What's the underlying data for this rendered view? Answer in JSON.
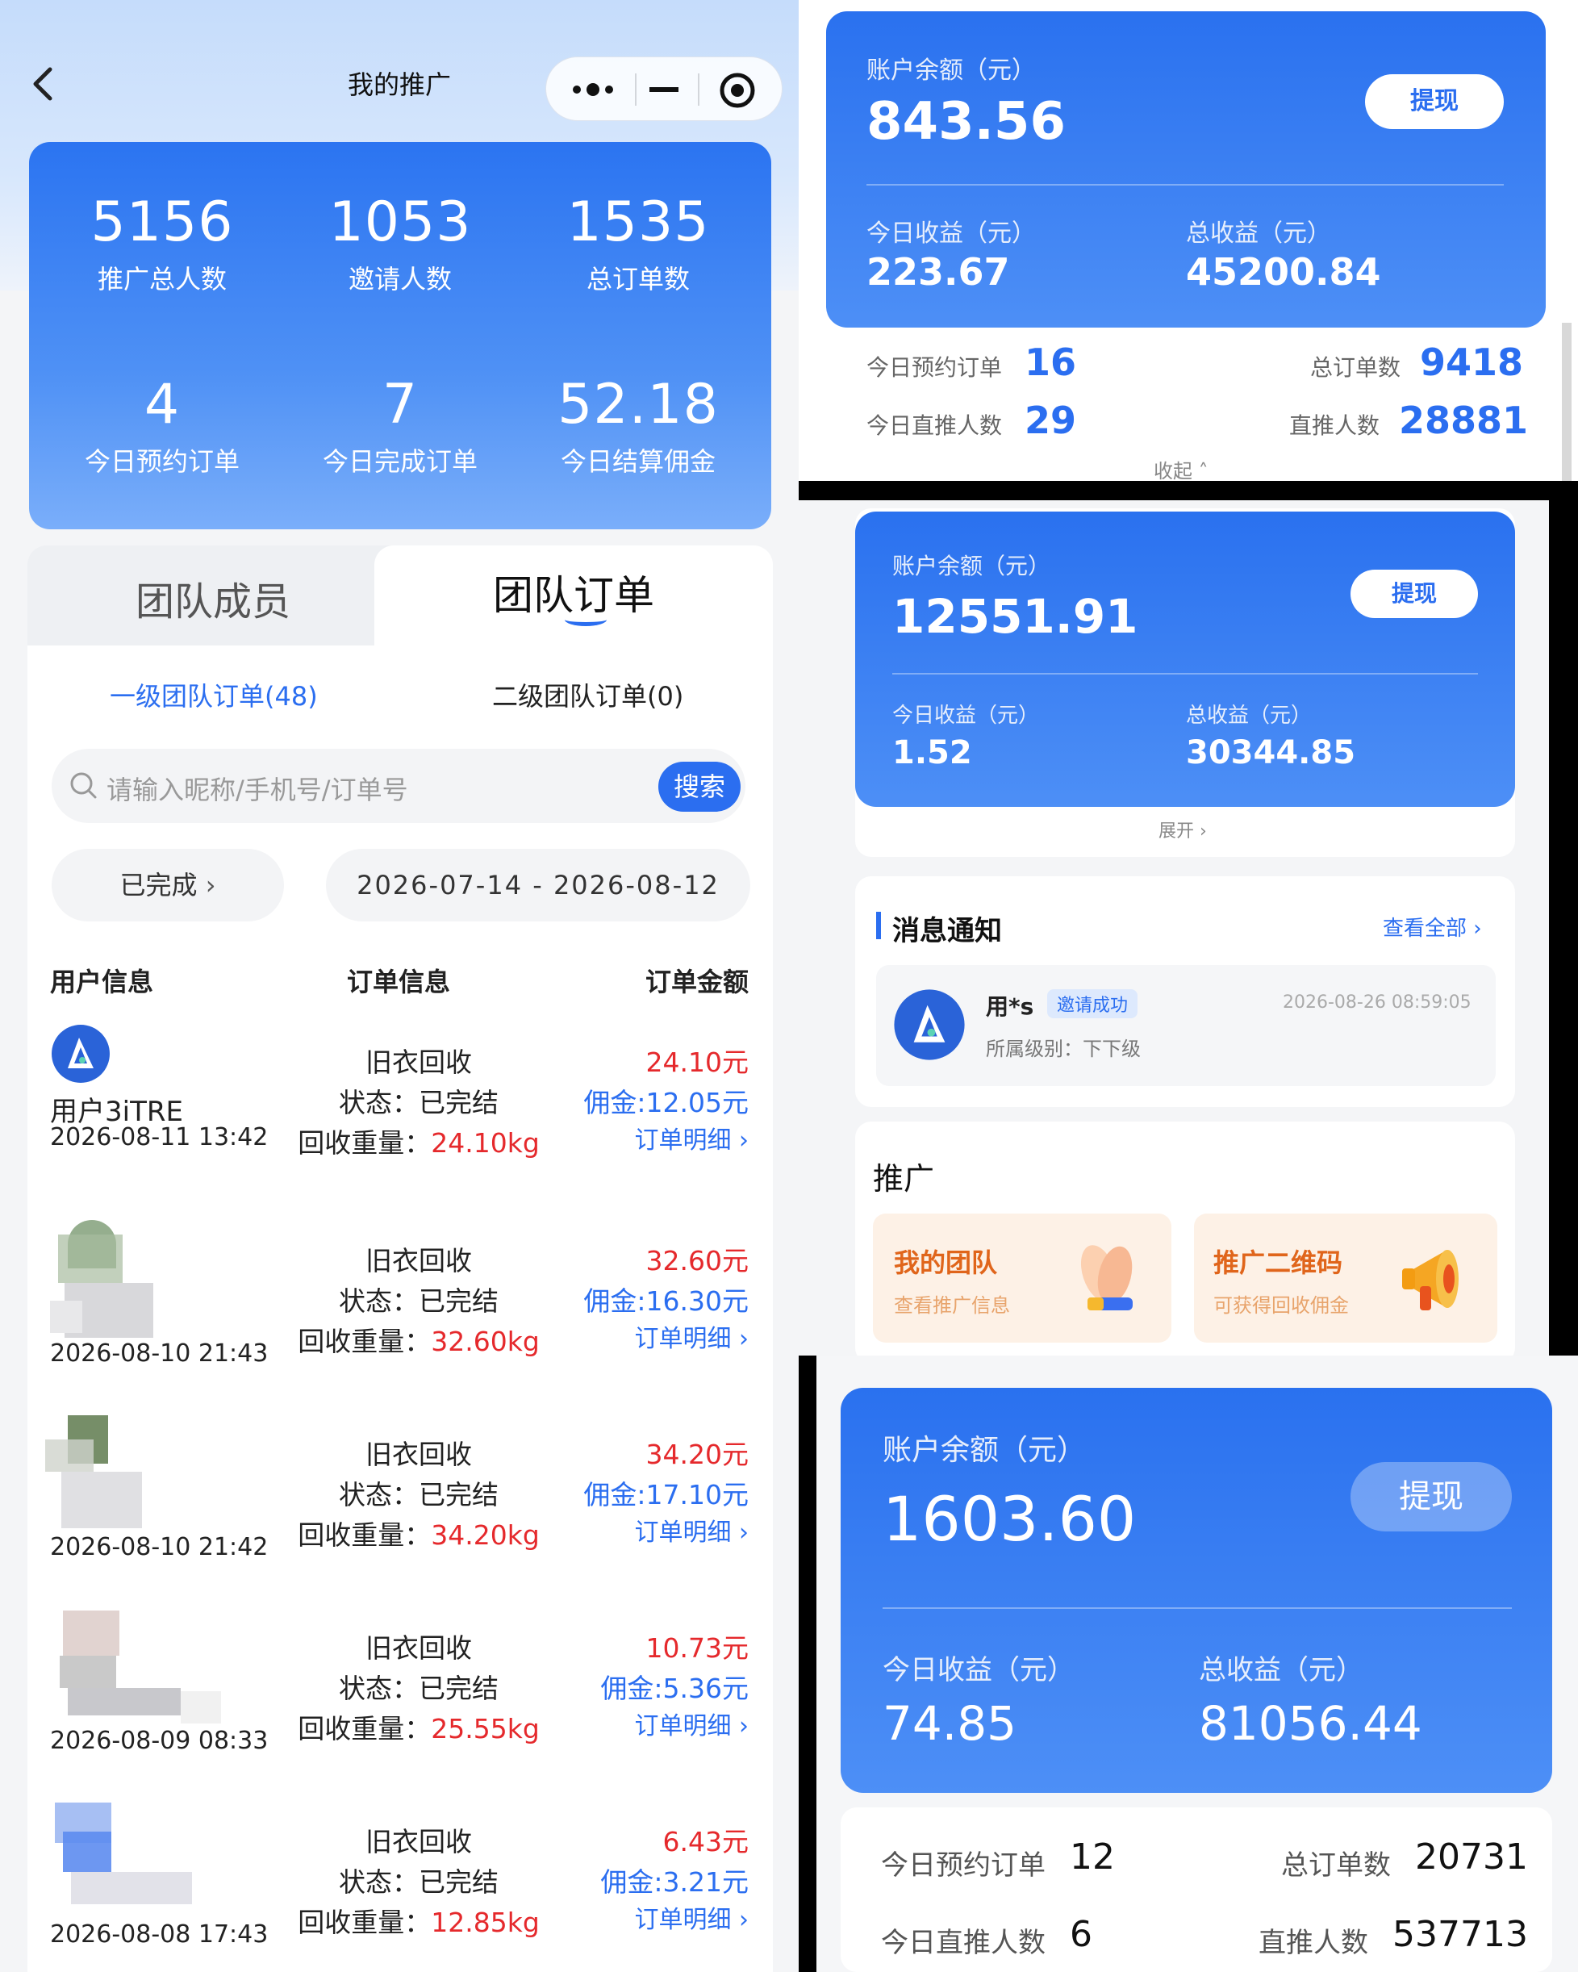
{
  "left": {
    "nav": {
      "title": "我的推广"
    },
    "stats": [
      {
        "value": "5156",
        "label": "推广总人数"
      },
      {
        "value": "1053",
        "label": "邀请人数"
      },
      {
        "value": "1535",
        "label": "总订单数"
      },
      {
        "value": "4",
        "label": "今日预约订单"
      },
      {
        "value": "7",
        "label": "今日完成订单"
      },
      {
        "value": "52.18",
        "label": "今日结算佣金"
      }
    ],
    "tabs": {
      "inactive": "团队成员",
      "active": "团队订单"
    },
    "subtabs": {
      "level1": "一级团队订单(48)",
      "level2": "二级团队订单(0)"
    },
    "search": {
      "placeholder": "请输入昵称/手机号/订单号",
      "button": "搜索"
    },
    "filters": {
      "status": "已完成",
      "date_range": "2026-07-14 - 2026-08-12"
    },
    "columns": {
      "user": "用户信息",
      "order": "订单信息",
      "amount": "订单金额"
    },
    "rows": [
      {
        "username": "用户3iTRE",
        "date": "2026-08-11 13:42",
        "type": "旧衣回收",
        "status_label": "状态：",
        "status": "已完结",
        "weight_label": "回收重量：",
        "weight": "24.10kg",
        "amount": "24.10元",
        "commission": "佣金:12.05元",
        "detail": "订单明细"
      },
      {
        "username": "",
        "date": "2026-08-10 21:43",
        "type": "旧衣回收",
        "status_label": "状态：",
        "status": "已完结",
        "weight_label": "回收重量：",
        "weight": "32.60kg",
        "amount": "32.60元",
        "commission": "佣金:16.30元",
        "detail": "订单明细"
      },
      {
        "username": "",
        "date": "2026-08-10 21:42",
        "type": "旧衣回收",
        "status_label": "状态：",
        "status": "已完结",
        "weight_label": "回收重量：",
        "weight": "34.20kg",
        "amount": "34.20元",
        "commission": "佣金:17.10元",
        "detail": "订单明细"
      },
      {
        "username": "",
        "date": "2026-08-09 08:33",
        "type": "旧衣回收",
        "status_label": "状态：",
        "status": "已完结",
        "weight_label": "回收重量：",
        "weight": "25.55kg",
        "amount": "10.73元",
        "commission": "佣金:5.36元",
        "detail": "订单明细"
      },
      {
        "username": "",
        "date": "2026-08-08 17:43",
        "type": "旧衣回收",
        "status_label": "状态：",
        "status": "已完结",
        "weight_label": "回收重量：",
        "weight": "12.85kg",
        "amount": "6.43元",
        "commission": "佣金:3.21元",
        "detail": "订单明细"
      }
    ]
  },
  "rt": {
    "balance_label": "账户余额（元）",
    "balance": "843.56",
    "withdraw": "提现",
    "today_label": "今日收益（元）",
    "today": "223.67",
    "total_label": "总收益（元）",
    "total": "45200.84",
    "kv": [
      {
        "label": "今日预约订单",
        "value": "16"
      },
      {
        "label": "总订单数",
        "value": "9418"
      },
      {
        "label": "今日直推人数",
        "value": "29"
      },
      {
        "label": "直推人数",
        "value": "28881"
      }
    ],
    "collapse": "收起"
  },
  "rm": {
    "balance_label": "账户余额（元）",
    "balance": "12551.91",
    "withdraw": "提现",
    "today_label": "今日收益（元）",
    "today": "1.52",
    "total_label": "总收益（元）",
    "total": "30344.85",
    "expand": "展开",
    "notice": {
      "title": "消息通知",
      "view_all": "查看全部",
      "user": "用*s",
      "tag": "邀请成功",
      "time": "2026-08-26 08:59:05",
      "level": "所属级别：下下级"
    },
    "promo": {
      "title": "推广",
      "team_title": "我的团队",
      "team_sub": "查看推广信息",
      "qr_title": "推广二维码",
      "qr_sub": "可获得回收佣金"
    }
  },
  "rb": {
    "balance_label": "账户余额（元）",
    "balance": "1603.60",
    "withdraw": "提现",
    "today_label": "今日收益（元）",
    "today": "74.85",
    "total_label": "总收益（元）",
    "total": "81056.44",
    "kv": [
      {
        "label": "今日预约订单",
        "value": "12"
      },
      {
        "label": "总订单数",
        "value": "20731"
      },
      {
        "label": "今日直推人数",
        "value": "6"
      },
      {
        "label": "直推人数",
        "value": "537713"
      }
    ]
  }
}
